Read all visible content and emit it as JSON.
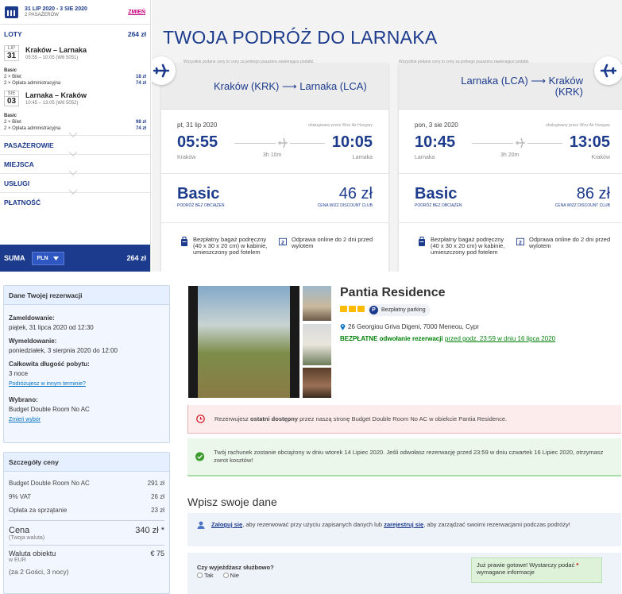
{
  "wizz": {
    "sidebar": {
      "trip_dates": "31 LIP 2020 - 3 SIE 2020",
      "passengers": "2 PASAŻERÓW",
      "change": "ZMIEŃ",
      "flights_label": "LOTY",
      "flights_total": "264 zł",
      "legs": [
        {
          "month": "LIP",
          "day": "31",
          "route": "Kraków – Larnaka",
          "times": "05:55 – 10:05 (W6 5051)",
          "fare": "Basic",
          "items": [
            {
              "label": "2 × Bilet",
              "price": "18 zł"
            },
            {
              "label": "2 × Opłata administracyjna",
              "price": "74 zł"
            }
          ]
        },
        {
          "month": "SIE",
          "day": "03",
          "route": "Larnaka – Kraków",
          "times": "10:45 – 13:05 (W6 5052)",
          "fare": "Basic",
          "items": [
            {
              "label": "2 × Bilet",
              "price": "98 zł"
            },
            {
              "label": "2 × Opłata administracyjna",
              "price": "74 zł"
            }
          ]
        }
      ],
      "sections": [
        "PASAŻEROWIE",
        "MIEJSCA",
        "USŁUGI",
        "PŁATNOŚĆ"
      ],
      "sum_label": "SUMA",
      "currency": "PLN",
      "sum_total": "264 zł"
    },
    "main": {
      "title": "TWOJA PODRÓŻ DO LARNAKA",
      "price_note": "Wszystkie podane ceny to ceny za jednego pasażera zawierające podatki.",
      "cards": [
        {
          "route": "Kraków (KRK) ⟶ Larnaka (LCA)",
          "date": "pt, 31 lip 2020",
          "operated": "obsługiwany przez Wizz Air Hungary",
          "dep_time": "05:55",
          "arr_time": "10:05",
          "dep_city": "Kraków",
          "arr_city": "Larnaka",
          "duration": "3h 10m",
          "fare": "Basic",
          "fare_sub": "PODRÓŻ BEZ OBCIĄŻEŃ",
          "price": "46 zł",
          "price_sub": "CENA WIZZ DISCOUNT CLUB"
        },
        {
          "route": "Larnaka (LCA) ⟶ Kraków (KRK)",
          "date": "pon, 3 sie 2020",
          "operated": "obsługiwany przez Wizz Air Hungary",
          "dep_time": "10:45",
          "arr_time": "13:05",
          "dep_city": "Larnaka",
          "arr_city": "Kraków",
          "duration": "3h 20m",
          "fare": "Basic",
          "fare_sub": "PODRÓŻ BEZ OBCIĄŻEŃ",
          "price": "86 zł",
          "price_sub": "CENA WIZZ DISCOUNT CLUB"
        }
      ],
      "feature_bag": "Bezpłatny bagaż podręczny (40 x 30 x 20 cm) w kabinie, umieszczony pod fotelem",
      "feature_checkin": "Odprawa online do 2 dni przed wylotem"
    }
  },
  "booking": {
    "res_box": {
      "title": "Dane Twojej rezerwacji",
      "checkin_label": "Zameldowanie:",
      "checkin_value": "piątek, 31 lipca 2020 od 12:30",
      "checkout_label": "Wymeldowanie:",
      "checkout_value": "poniedziałek, 3 sierpnia 2020 do 12:00",
      "length_label": "Całkowita długość pobytu:",
      "length_value": "3 noce",
      "other_dates": "Podróżujesz w innym terminie?",
      "selected_label": "Wybrano:",
      "selected_value": "Budget Double Room No AC",
      "change_choice": "Zmień wybór"
    },
    "price_box": {
      "title": "Szczegóły ceny",
      "rows": [
        {
          "label": "Budget Double Room No AC",
          "value": "291 zł"
        },
        {
          "label": "9% VAT",
          "value": "26 zł"
        },
        {
          "label": "Opłata za sprzątanie",
          "value": "23 zł"
        }
      ],
      "total_label": "Cena",
      "total_sub": "(Twoja waluta)",
      "total_value": "340 zł *",
      "local_label": "Waluta obiektu",
      "local_sub": "w EUR",
      "local_value": "€ 75",
      "guests": "(za 2 Gości, 3 nocy)"
    },
    "hotel": {
      "name": "Pantia Residence",
      "parking": "Bezpłatny parking",
      "address": "26 Georgiou Griva Digeni, 7000 Meneou, Cypr",
      "cancel_bold": "BEZPŁATNE odwołanie rezerwacji",
      "cancel_rest": "przed godz. 23:59 w dniu 16 lipca 2020"
    },
    "alert_red": {
      "pre": "Rezerwujesz ",
      "bold": "ostatni dostępny",
      "post": " przez naszą stronę Budget Double Room No AC w obiekcie Pantia Residence."
    },
    "alert_green": "Twój rachunek zostanie obciążony w dniu wtorek 14 Lipiec 2020. Jeśli odwołasz rezerwację przed 23:59 w dniu czwartek 16 Lipiec 2020, otrzymasz zwrot kosztów!",
    "form": {
      "heading": "Wpisz swoje dane",
      "login_link": "Zaloguj się",
      "login_mid": ", aby rezerwować przy użyciu zapisanych danych lub ",
      "register_link": "zarejestruj się",
      "login_end": ", aby zarządzać swoimi rezerwacjami podczas podróży!",
      "business_q": "Czy wyjeżdżasz służbowo?",
      "yes": "Tak",
      "no": "Nie",
      "ready_text": "Już prawie gotowe! Wystarczy podać",
      "ready_star": "*",
      "ready_rest": "wymagane informacje"
    }
  }
}
